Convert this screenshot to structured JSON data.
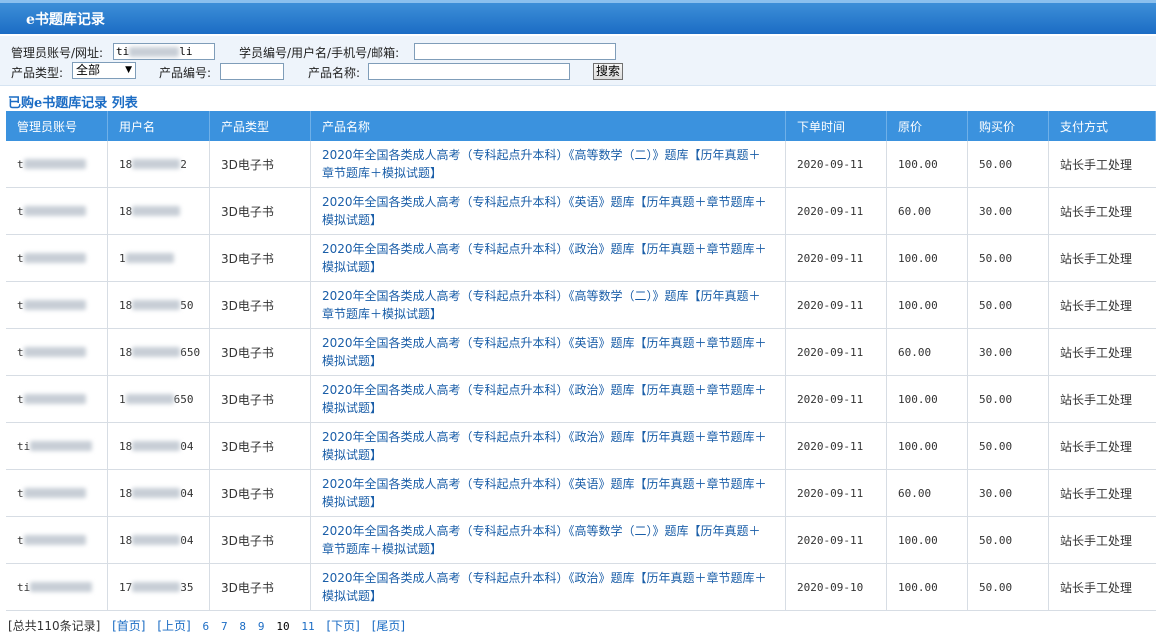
{
  "title": "e书题库记录",
  "search": {
    "admin_label": "管理员账号/网址:",
    "admin_value": "ti",
    "admin_value_tail": "li",
    "student_label": "学员编号/用户名/手机号/邮箱:",
    "student_value": "",
    "type_label": "产品类型:",
    "type_selected": "全部",
    "code_label": "产品编号:",
    "code_value": "",
    "name_label": "产品名称:",
    "name_value": "",
    "search_button": "搜索"
  },
  "list_heading": "已购e书题库记录 列表",
  "table": {
    "headers": [
      "管理员账号",
      "用户名",
      "产品类型",
      "产品名称",
      "下单时间",
      "原价",
      "购买价",
      "支付方式"
    ],
    "rows": [
      {
        "admin": "t",
        "user": "18",
        "user_tail": "2",
        "type": "3D电子书",
        "product": "2020年全国各类成人高考（专科起点升本科）《高等数学（二）》题库【历年真题＋章节题库＋模拟试题】",
        "date": "2020-09-11",
        "price": "100.00",
        "paid": "50.00",
        "pay": "站长手工处理"
      },
      {
        "admin": "t",
        "user": "18",
        "user_tail": "",
        "type": "3D电子书",
        "product": "2020年全国各类成人高考（专科起点升本科）《英语》题库【历年真题＋章节题库＋模拟试题】",
        "date": "2020-09-11",
        "price": "60.00",
        "paid": "30.00",
        "pay": "站长手工处理"
      },
      {
        "admin": "t",
        "user": "1",
        "user_tail": "",
        "type": "3D电子书",
        "product": "2020年全国各类成人高考（专科起点升本科）《政治》题库【历年真题＋章节题库＋模拟试题】",
        "date": "2020-09-11",
        "price": "100.00",
        "paid": "50.00",
        "pay": "站长手工处理"
      },
      {
        "admin": "t",
        "user": "18",
        "user_tail": "50",
        "type": "3D电子书",
        "product": "2020年全国各类成人高考（专科起点升本科）《高等数学（二）》题库【历年真题＋章节题库＋模拟试题】",
        "date": "2020-09-11",
        "price": "100.00",
        "paid": "50.00",
        "pay": "站长手工处理"
      },
      {
        "admin": "t",
        "user": "18",
        "user_tail": "650",
        "type": "3D电子书",
        "product": "2020年全国各类成人高考（专科起点升本科）《英语》题库【历年真题＋章节题库＋模拟试题】",
        "date": "2020-09-11",
        "price": "60.00",
        "paid": "30.00",
        "pay": "站长手工处理"
      },
      {
        "admin": "t",
        "user": "1",
        "user_tail": "650",
        "type": "3D电子书",
        "product": "2020年全国各类成人高考（专科起点升本科）《政治》题库【历年真题＋章节题库＋模拟试题】",
        "date": "2020-09-11",
        "price": "100.00",
        "paid": "50.00",
        "pay": "站长手工处理"
      },
      {
        "admin": "ti",
        "user": "18",
        "user_tail": "04",
        "type": "3D电子书",
        "product": "2020年全国各类成人高考（专科起点升本科）《政治》题库【历年真题＋章节题库＋模拟试题】",
        "date": "2020-09-11",
        "price": "100.00",
        "paid": "50.00",
        "pay": "站长手工处理"
      },
      {
        "admin": "t",
        "user": "18",
        "user_tail": "04",
        "type": "3D电子书",
        "product": "2020年全国各类成人高考（专科起点升本科）《英语》题库【历年真题＋章节题库＋模拟试题】",
        "date": "2020-09-11",
        "price": "60.00",
        "paid": "30.00",
        "pay": "站长手工处理"
      },
      {
        "admin": "t",
        "user": "18",
        "user_tail": "04",
        "type": "3D电子书",
        "product": "2020年全国各类成人高考（专科起点升本科）《高等数学（二）》题库【历年真题＋章节题库＋模拟试题】",
        "date": "2020-09-11",
        "price": "100.00",
        "paid": "50.00",
        "pay": "站长手工处理"
      },
      {
        "admin": "ti",
        "user": "17",
        "user_tail": "35",
        "type": "3D电子书",
        "product": "2020年全国各类成人高考（专科起点升本科）《政治》题库【历年真题＋章节题库＋模拟试题】",
        "date": "2020-09-10",
        "price": "100.00",
        "paid": "50.00",
        "pay": "站长手工处理"
      }
    ]
  },
  "pager": {
    "total": "[总共110条记录]",
    "first": "[首页]",
    "prev": "[上页]",
    "pages": [
      "6",
      "7",
      "8",
      "9",
      "10",
      "11"
    ],
    "current": "10",
    "next": "[下页]",
    "last": "[尾页]"
  },
  "colors": {
    "header_bg": "#3b92de",
    "title_bg": "#1b6cc4",
    "link": "#1a5ea8"
  }
}
